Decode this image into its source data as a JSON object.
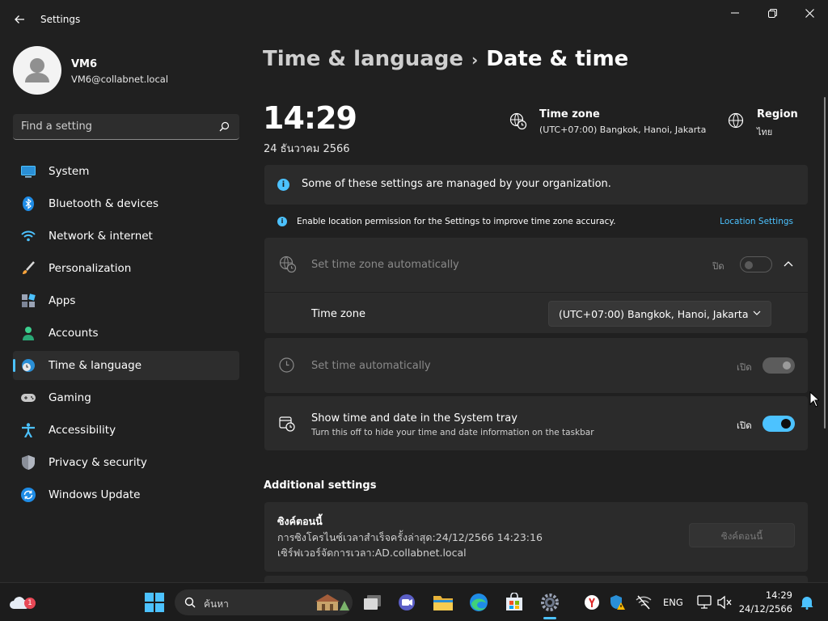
{
  "window": {
    "title": "Settings"
  },
  "profile": {
    "name": "VM6",
    "email": "VM6@collabnet.local"
  },
  "search": {
    "placeholder": "Find a setting"
  },
  "sidebar": {
    "items": [
      {
        "label": "System",
        "icon": "monitor-icon"
      },
      {
        "label": "Bluetooth & devices",
        "icon": "bluetooth-icon"
      },
      {
        "label": "Network & internet",
        "icon": "wifi-icon"
      },
      {
        "label": "Personalization",
        "icon": "brush-icon"
      },
      {
        "label": "Apps",
        "icon": "apps-icon"
      },
      {
        "label": "Accounts",
        "icon": "person-icon"
      },
      {
        "label": "Time & language",
        "icon": "globe-clock-icon",
        "active": true
      },
      {
        "label": "Gaming",
        "icon": "gamepad-icon"
      },
      {
        "label": "Accessibility",
        "icon": "accessibility-icon"
      },
      {
        "label": "Privacy & security",
        "icon": "shield-icon"
      },
      {
        "label": "Windows Update",
        "icon": "update-icon"
      }
    ]
  },
  "header": {
    "parent": "Time & language",
    "current": "Date & time"
  },
  "summary": {
    "time": "14:29",
    "date": "24 ธันวาคม 2566",
    "timezone_title": "Time zone",
    "timezone_value": "(UTC+07:00) Bangkok, Hanoi, Jakarta",
    "region_title": "Region",
    "region_value": "ไทย"
  },
  "notices": {
    "managed": "Some of these settings are managed by your organization.",
    "location": "Enable location permission for the Settings to improve time zone accuracy.",
    "location_link": "Location Settings"
  },
  "settings": {
    "auto_timezone": {
      "label": "Set time zone automatically",
      "state": "ปิด"
    },
    "timezone": {
      "label": "Time zone",
      "value": "(UTC+07:00) Bangkok, Hanoi, Jakarta"
    },
    "auto_time": {
      "label": "Set time automatically",
      "state": "เปิด"
    },
    "tray": {
      "label": "Show time and date in the System tray",
      "description": "Turn this off to hide your time and date information on the taskbar",
      "state": "เปิด"
    }
  },
  "additional": {
    "heading": "Additional settings",
    "sync_title": "ซิงค์ตอนนี้",
    "sync_last": "การซิงโครไนซ์เวลาสำเร็จครั้งล่าสุด:24/12/2566 14:23:16",
    "sync_server": "เซิร์ฟเวอร์จัดการเวลา:AD.collabnet.local",
    "sync_button": "ซิงค์ตอนนี้"
  },
  "taskbar": {
    "search_placeholder": "ค้นหา",
    "language": "ENG",
    "time": "14:29",
    "date": "24/12/2566",
    "weather_badge": "1"
  },
  "colors": {
    "accent": "#4cc2ff",
    "background": "#202020",
    "card": "#2b2b2b"
  }
}
